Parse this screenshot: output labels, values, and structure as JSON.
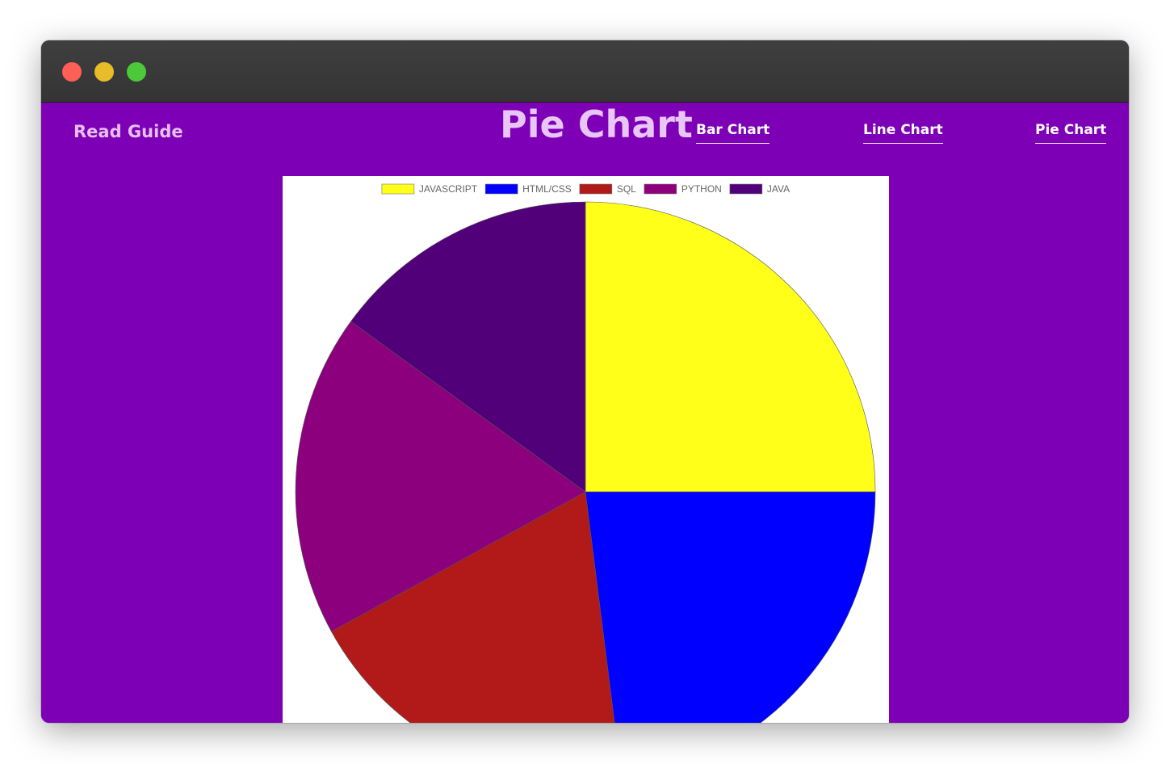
{
  "window": {
    "controls": [
      "close",
      "minimize",
      "maximize"
    ]
  },
  "header": {
    "read_guide": "Read Guide",
    "title": "Pie Chart",
    "nav": [
      {
        "label": "Bar Chart"
      },
      {
        "label": "Line Chart"
      },
      {
        "label": "Pie Chart"
      }
    ]
  },
  "colors": {
    "page_background": "#7e00b6",
    "titlebar": "#3a3a3a"
  },
  "chart_data": {
    "type": "pie",
    "categories": [
      "JAVASCRIPT",
      "HTML/CSS",
      "SQL",
      "PYTHON",
      "JAVA"
    ],
    "values": [
      25,
      23,
      19,
      18,
      15
    ],
    "colors": [
      "#ffff1a",
      "#0000ff",
      "#b11a18",
      "#8c007d",
      "#52007a"
    ],
    "legend": "top",
    "start_angle": "top",
    "direction": "clockwise"
  }
}
